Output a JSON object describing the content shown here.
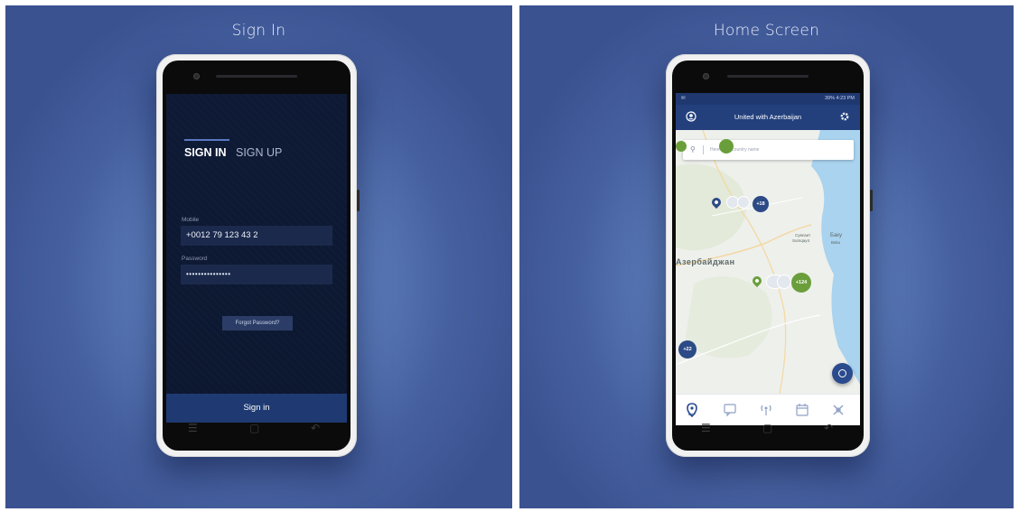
{
  "left_panel": {
    "title": "Sign In",
    "tabs": {
      "signin": "SIGN IN",
      "signup": "SIGN UP"
    },
    "mobile_label": "Mobile",
    "mobile_value": "+0012 79 123 43 2",
    "password_label": "Password",
    "password_value": "•••••••••••••••",
    "forgot_label": "Forgot Password?",
    "signin_button": "Sign in"
  },
  "right_panel": {
    "title": "Home Screen",
    "status": {
      "right": "39%  4:23 PM"
    },
    "appbar_title": "United with Azerbaijan",
    "search_placeholder": "Here write country name",
    "map_labels": {
      "country": "Азербайджан",
      "city1": "Sumqayıt",
      "city1_cyr": "Сумгаит",
      "city2": "Baku",
      "city2_cyr": "Баку"
    },
    "clusters": [
      "+18",
      "+124",
      "+22"
    ],
    "bottom_nav": {
      "map_label": "MAP"
    }
  },
  "colors": {
    "accent": "#23407d",
    "green": "#6a9e3b",
    "bg": "#5d7dbb"
  }
}
